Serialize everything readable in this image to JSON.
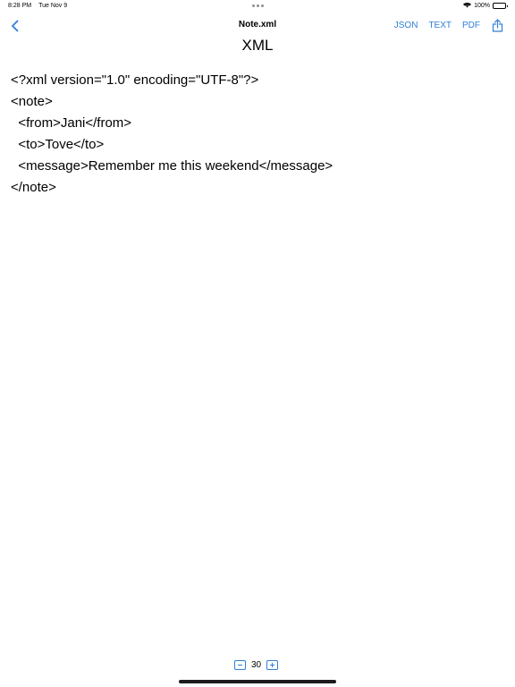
{
  "status": {
    "time": "8:28 PM",
    "date": "Tue Nov 9",
    "battery": "100%"
  },
  "nav": {
    "title": "Note.xml",
    "actions": [
      "JSON",
      "TEXT",
      "PDF"
    ]
  },
  "heading": "XML",
  "document": {
    "lines": [
      "<?xml version=\"1.0\" encoding=\"UTF-8\"?>",
      "<note>",
      "  <from>Jani</from>",
      "  <to>Tove</to>",
      "  <message>Remember me this weekend</message>",
      "</note>"
    ]
  },
  "font_control": {
    "size": "30"
  },
  "colors": {
    "accent": "#2f7fd6"
  },
  "icons": {
    "back": "chevron-left-icon",
    "share": "share-icon",
    "wifi": "wifi-icon",
    "battery": "battery-icon",
    "decrease": "minus-icon",
    "increase": "plus-icon"
  }
}
